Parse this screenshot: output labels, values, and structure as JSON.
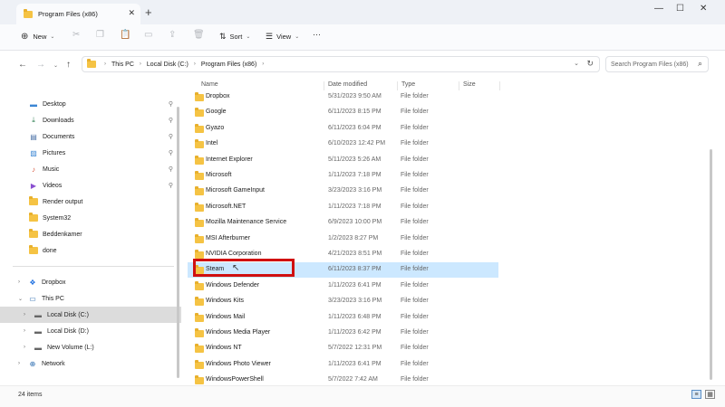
{
  "window": {
    "tab_title": "Program Files (x86)",
    "new_tab": "+",
    "controls": [
      "—",
      "☐",
      "✕"
    ]
  },
  "toolbar": {
    "new_label": "New",
    "sort_label": "Sort",
    "view_label": "View",
    "more_label": "···"
  },
  "address": {
    "back": "←",
    "forward": "→",
    "up": "↑",
    "segments": [
      "This PC",
      "Local Disk (C:)",
      "Program Files (x86)"
    ],
    "search_placeholder": "Search Program Files (x86)"
  },
  "sidebar": {
    "quick_access": [
      {
        "label": "Desktop",
        "icon": "desktop-icon",
        "pinned": true
      },
      {
        "label": "Downloads",
        "icon": "download-icon",
        "pinned": true
      },
      {
        "label": "Documents",
        "icon": "document-icon",
        "pinned": true
      },
      {
        "label": "Pictures",
        "icon": "pictures-icon",
        "pinned": true
      },
      {
        "label": "Music",
        "icon": "music-icon",
        "pinned": true
      },
      {
        "label": "Videos",
        "icon": "video-icon",
        "pinned": true
      },
      {
        "label": "Render output",
        "icon": "folder-icon",
        "pinned": false
      },
      {
        "label": "System32",
        "icon": "folder-icon",
        "pinned": false
      },
      {
        "label": "Beddenkamer",
        "icon": "folder-icon",
        "pinned": false
      },
      {
        "label": "done",
        "icon": "folder-icon",
        "pinned": false
      }
    ],
    "tree": [
      {
        "label": "Dropbox",
        "icon": "dropbox-icon",
        "chevron": "›"
      },
      {
        "label": "This PC",
        "icon": "pc-icon",
        "chevron": "⌄"
      },
      {
        "label": "Local Disk (C:)",
        "icon": "drive-icon",
        "chevron": "›",
        "selected": true
      },
      {
        "label": "Local Disk (D:)",
        "icon": "drive-icon",
        "chevron": "›"
      },
      {
        "label": "New Volume (L:)",
        "icon": "drive-icon",
        "chevron": "›"
      },
      {
        "label": "Network",
        "icon": "network-icon",
        "chevron": "›"
      }
    ]
  },
  "columns": {
    "name": "Name",
    "date": "Date modified",
    "type": "Type",
    "size": "Size"
  },
  "files": [
    {
      "name": "Dropbox",
      "date": "5/31/2023 9:50 AM",
      "type": "File folder"
    },
    {
      "name": "Google",
      "date": "6/11/2023 8:15 PM",
      "type": "File folder"
    },
    {
      "name": "Gyazo",
      "date": "6/11/2023 6:04 PM",
      "type": "File folder"
    },
    {
      "name": "Intel",
      "date": "6/10/2023 12:42 PM",
      "type": "File folder"
    },
    {
      "name": "Internet Explorer",
      "date": "5/11/2023 5:26 AM",
      "type": "File folder"
    },
    {
      "name": "Microsoft",
      "date": "1/11/2023 7:18 PM",
      "type": "File folder"
    },
    {
      "name": "Microsoft GameInput",
      "date": "3/23/2023 3:16 PM",
      "type": "File folder"
    },
    {
      "name": "Microsoft.NET",
      "date": "1/11/2023 7:18 PM",
      "type": "File folder"
    },
    {
      "name": "Mozilla Maintenance Service",
      "date": "6/9/2023 10:00 PM",
      "type": "File folder"
    },
    {
      "name": "MSI Afterburner",
      "date": "1/2/2023 8:27 PM",
      "type": "File folder"
    },
    {
      "name": "NVIDIA Corporation",
      "date": "4/21/2023 8:51 PM",
      "type": "File folder"
    },
    {
      "name": "Steam",
      "date": "6/11/2023 8:37 PM",
      "type": "File folder"
    },
    {
      "name": "Windows Defender",
      "date": "1/11/2023 6:41 PM",
      "type": "File folder"
    },
    {
      "name": "Windows Kits",
      "date": "3/23/2023 3:16 PM",
      "type": "File folder"
    },
    {
      "name": "Windows Mail",
      "date": "1/11/2023 6:48 PM",
      "type": "File folder"
    },
    {
      "name": "Windows Media Player",
      "date": "1/11/2023 6:42 PM",
      "type": "File folder"
    },
    {
      "name": "Windows NT",
      "date": "5/7/2022 12:31 PM",
      "type": "File folder"
    },
    {
      "name": "Windows Photo Viewer",
      "date": "1/11/2023 6:41 PM",
      "type": "File folder"
    },
    {
      "name": "WindowsPowerShell",
      "date": "5/7/2022 7:42 AM",
      "type": "File folder"
    }
  ],
  "selected_file": "Steam",
  "highlight_color": "#d01010",
  "status": {
    "item_count": "24 items"
  }
}
